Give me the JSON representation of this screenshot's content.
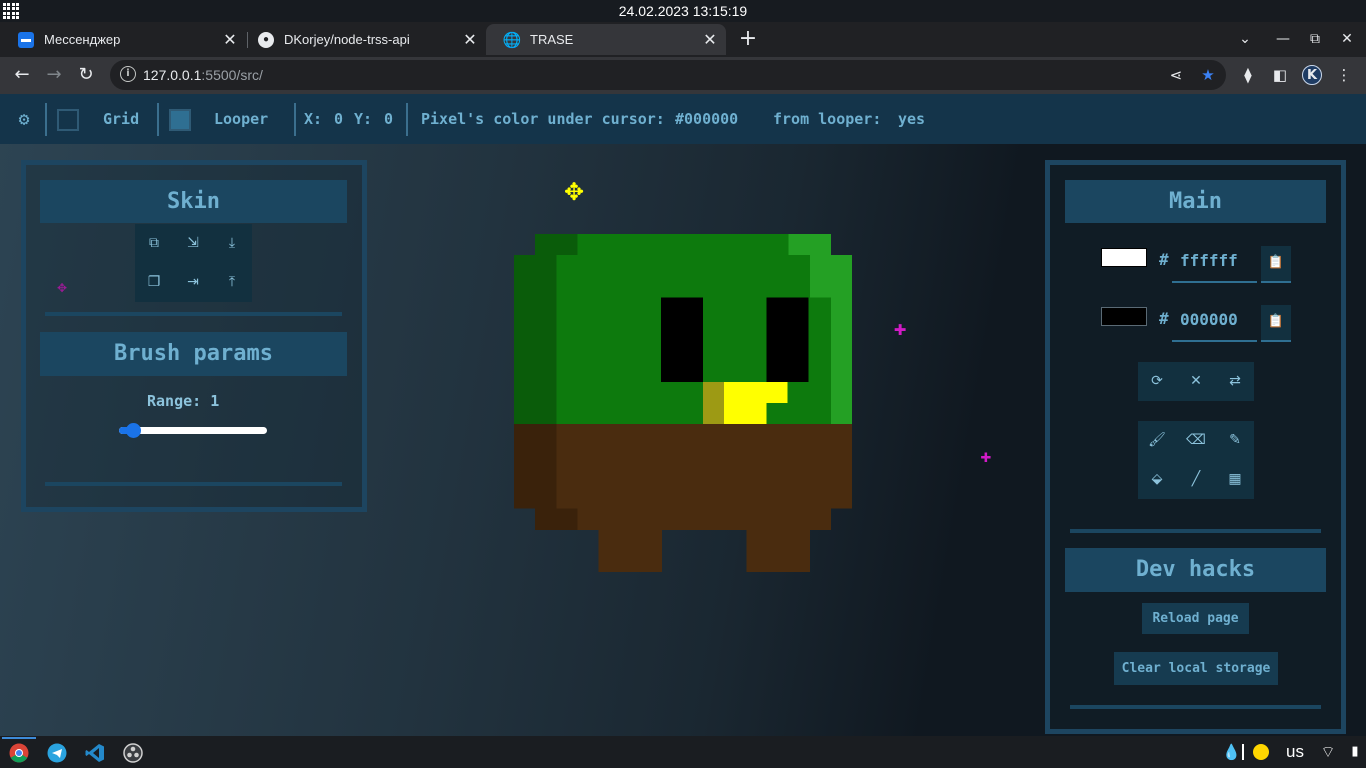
{
  "os": {
    "clock": "24.02.2023 13:15:19"
  },
  "browser": {
    "tabs": [
      {
        "title": "Мессенджер",
        "icon": "messenger-icon"
      },
      {
        "title": "DKorjey/node-trss-api",
        "icon": "github-icon"
      },
      {
        "title": "TRASE",
        "icon": "globe-icon",
        "active": true
      }
    ],
    "url_host": "127.0.0.1",
    "url_rest": ":5500/src/",
    "profile_initial": "K"
  },
  "app": {
    "bar": {
      "grid_label": "Grid",
      "looper_label": "Looper",
      "x_label": "X:",
      "x_value": "0",
      "y_label": "Y:",
      "y_value": "0",
      "pixel_color_label": "Pixel's color under cursor:",
      "pixel_color_value": "#000000",
      "from_looper_label": "from looper:",
      "from_looper_value": "yes"
    },
    "skin_panel": {
      "title": "Skin"
    },
    "brush_panel": {
      "title": "Brush params",
      "range_label": "Range:",
      "range_value": "1"
    },
    "main_panel": {
      "title": "Main",
      "primary_color": {
        "hash": "#",
        "value": "ffffff",
        "swatch": "#ffffff"
      },
      "secondary_color": {
        "hash": "#",
        "value": "000000",
        "swatch": "#000000"
      }
    },
    "dev_panel": {
      "title": "Dev hacks",
      "reload_label": "Reload page",
      "clear_label": "Clear local storage"
    },
    "colors": {
      "accent_text": "#6fb0d0",
      "green": "#0d7a0d",
      "dark_green": "#0a5c0a",
      "light_green": "#24a024",
      "brown": "#4a2c0f",
      "dark_brown": "#3a220b",
      "yellow": "#ffff00",
      "dark_yellow": "#9d9a14",
      "magenta": "#d11bc6"
    }
  },
  "taskbar": {
    "keyboard_layout": "us"
  }
}
